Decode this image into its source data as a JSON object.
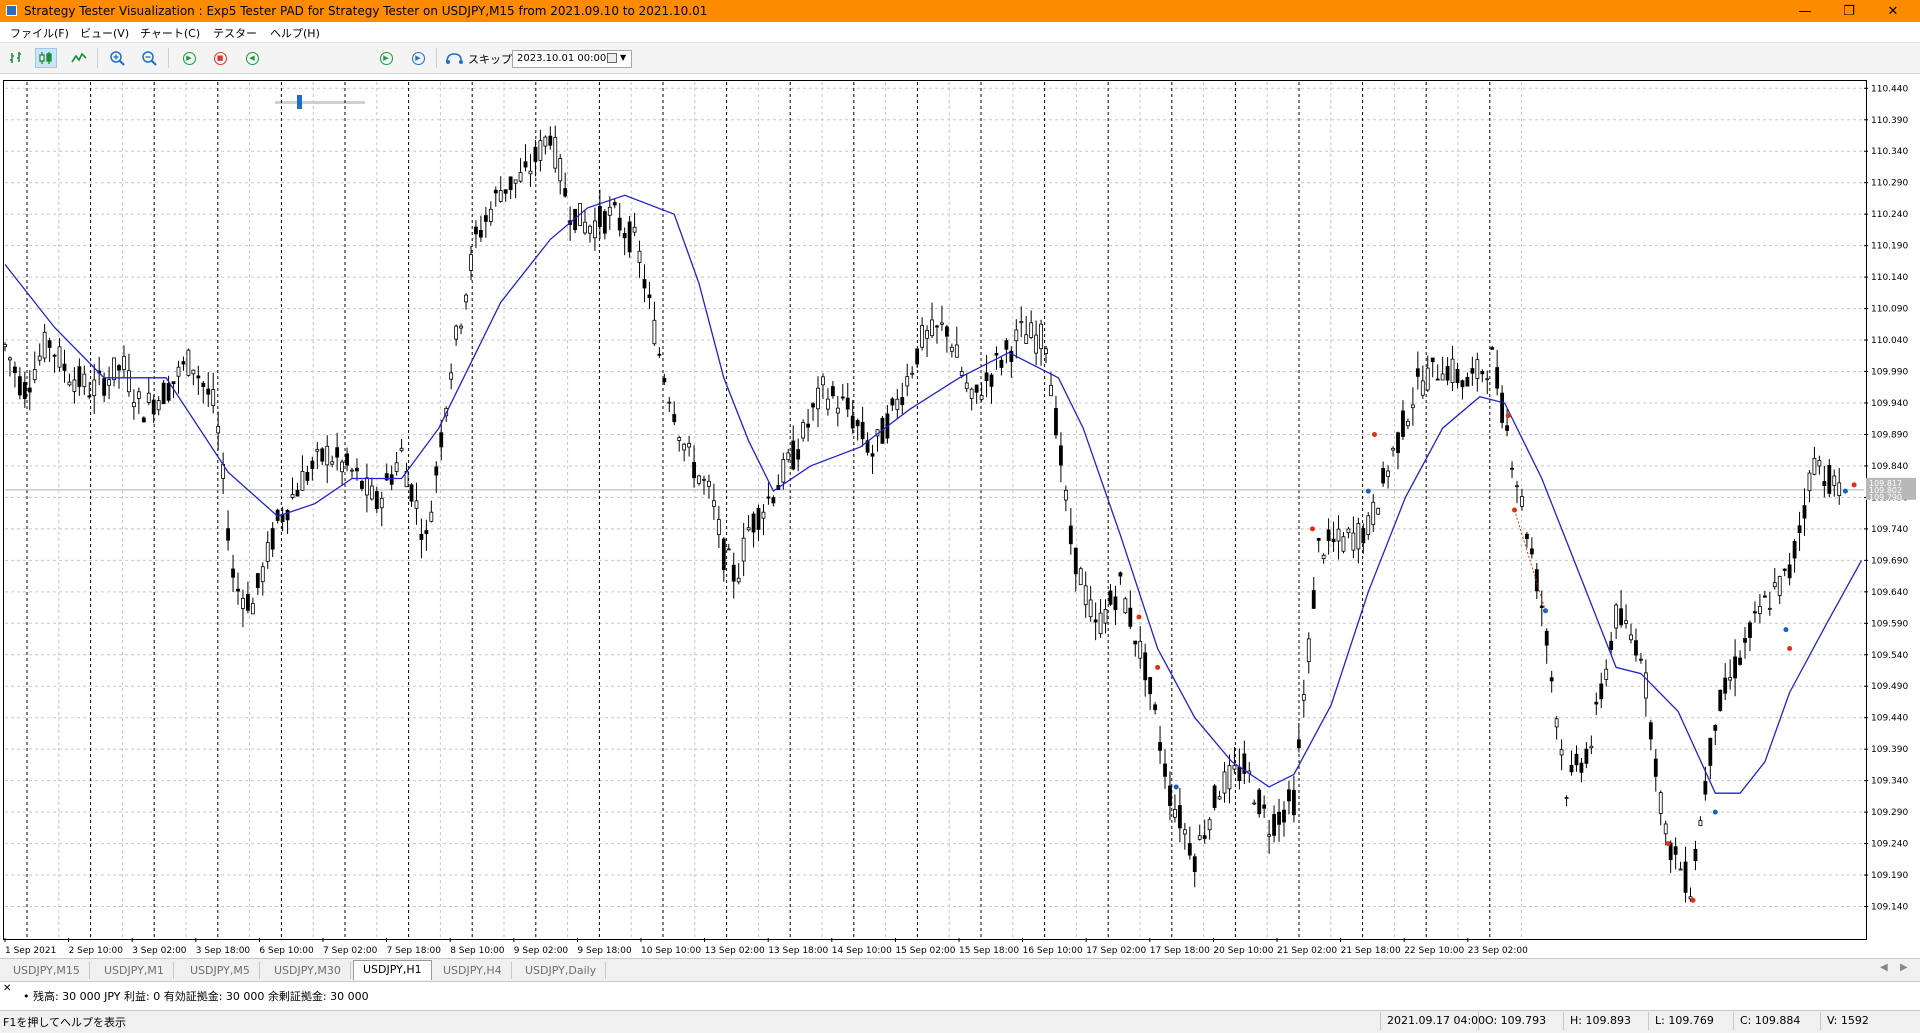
{
  "window": {
    "title": "Strategy Tester Visualization : Exp5 Tester PAD for Strategy Tester on USDJPY,M15 from 2021.09.10 to 2021.10.01",
    "minimize": "—",
    "maximize": "❐",
    "close": "✕"
  },
  "menu": {
    "items": [
      {
        "label": "ファイル(F)"
      },
      {
        "label": "ビュー(V)"
      },
      {
        "label": "チャート(C)"
      },
      {
        "label": "テスター"
      },
      {
        "label": "ヘルプ(H)"
      }
    ]
  },
  "toolbar": {
    "skip_label": "スキップ",
    "date_value": "2023.10.01 00:00",
    "icons": [
      "bar-chart-icon",
      "candlestick-icon",
      "line-chart-icon",
      "zoom-in-icon",
      "zoom-out-icon",
      "play-icon",
      "stop-icon",
      "rewind-icon",
      "speed-slider",
      "fast-forward-icon",
      "skip-end-icon",
      "skip-icon",
      "calendar-icon"
    ],
    "speed_level": 0.25
  },
  "chart_data": {
    "type": "candlestick",
    "symbol": "USDJPY",
    "timeframe": "H1",
    "price_ticks": [
      "110.440",
      "110.390",
      "110.340",
      "110.290",
      "110.240",
      "110.190",
      "110.140",
      "110.090",
      "110.040",
      "109.990",
      "109.940",
      "109.890",
      "109.840",
      "109.790",
      "109.740",
      "109.690",
      "109.640",
      "109.590",
      "109.540",
      "109.490",
      "109.440",
      "109.390",
      "109.340",
      "109.290",
      "109.240",
      "109.190",
      "109.140"
    ],
    "price_min": 109.09,
    "price_max": 110.45,
    "current_price_labels": [
      "109.817",
      "109.802",
      "109.790"
    ],
    "time_labels": [
      "1 Sep 2021",
      "2 Sep 10:00",
      "3 Sep 02:00",
      "3 Sep 18:00",
      "6 Sep 10:00",
      "7 Sep 02:00",
      "7 Sep 18:00",
      "8 Sep 10:00",
      "9 Sep 02:00",
      "9 Sep 18:00",
      "10 Sep 10:00",
      "13 Sep 02:00",
      "13 Sep 18:00",
      "14 Sep 10:00",
      "15 Sep 02:00",
      "15 Sep 18:00",
      "16 Sep 10:00",
      "17 Sep 02:00",
      "17 Sep 18:00",
      "20 Sep 10:00",
      "21 Sep 02:00",
      "21 Sep 18:00",
      "22 Sep 10:00",
      "23 Sep 02:00"
    ],
    "price_path": [
      [
        0,
        110.03
      ],
      [
        15,
        109.96
      ],
      [
        35,
        110.04
      ],
      [
        50,
        109.99
      ],
      [
        70,
        109.96
      ],
      [
        95,
        110.0
      ],
      [
        110,
        109.93
      ],
      [
        130,
        109.96
      ],
      [
        150,
        110.01
      ],
      [
        170,
        109.93
      ],
      [
        185,
        109.65
      ],
      [
        200,
        109.62
      ],
      [
        220,
        109.75
      ],
      [
        240,
        109.82
      ],
      [
        260,
        109.86
      ],
      [
        280,
        109.83
      ],
      [
        300,
        109.78
      ],
      [
        320,
        109.86
      ],
      [
        340,
        109.72
      ],
      [
        360,
        110.0
      ],
      [
        380,
        110.2
      ],
      [
        400,
        110.28
      ],
      [
        420,
        110.3
      ],
      [
        440,
        110.37
      ],
      [
        455,
        110.25
      ],
      [
        470,
        110.22
      ],
      [
        490,
        110.24
      ],
      [
        510,
        110.19
      ],
      [
        530,
        110.0
      ],
      [
        550,
        109.86
      ],
      [
        570,
        109.79
      ],
      [
        580,
        109.7
      ],
      [
        590,
        109.66
      ],
      [
        600,
        109.74
      ],
      [
        620,
        109.8
      ],
      [
        640,
        109.87
      ],
      [
        660,
        109.96
      ],
      [
        680,
        109.93
      ],
      [
        700,
        109.86
      ],
      [
        720,
        109.94
      ],
      [
        740,
        110.04
      ],
      [
        760,
        110.06
      ],
      [
        780,
        109.94
      ],
      [
        800,
        110.0
      ],
      [
        820,
        110.05
      ],
      [
        840,
        110.04
      ],
      [
        860,
        109.72
      ],
      [
        880,
        109.58
      ],
      [
        900,
        109.65
      ],
      [
        920,
        109.52
      ],
      [
        940,
        109.32
      ],
      [
        960,
        109.22
      ],
      [
        980,
        109.33
      ],
      [
        1000,
        109.36
      ],
      [
        1020,
        109.27
      ],
      [
        1040,
        109.31
      ],
      [
        1060,
        109.71
      ],
      [
        1080,
        109.72
      ],
      [
        1100,
        109.74
      ],
      [
        1120,
        109.86
      ],
      [
        1140,
        109.97
      ],
      [
        1160,
        110.0
      ],
      [
        1180,
        109.97
      ],
      [
        1200,
        110.01
      ],
      [
        1220,
        109.82
      ],
      [
        1240,
        109.62
      ],
      [
        1260,
        109.33
      ],
      [
        1280,
        109.4
      ],
      [
        1300,
        109.6
      ],
      [
        1320,
        109.55
      ],
      [
        1340,
        109.25
      ],
      [
        1360,
        109.17
      ],
      [
        1380,
        109.44
      ],
      [
        1400,
        109.54
      ],
      [
        1420,
        109.62
      ],
      [
        1440,
        109.67
      ],
      [
        1460,
        109.85
      ],
      [
        1480,
        109.8
      ]
    ],
    "ma_path": [
      [
        0,
        110.16
      ],
      [
        40,
        110.06
      ],
      [
        80,
        109.98
      ],
      [
        130,
        109.98
      ],
      [
        180,
        109.83
      ],
      [
        220,
        109.76
      ],
      [
        250,
        109.78
      ],
      [
        280,
        109.82
      ],
      [
        320,
        109.82
      ],
      [
        350,
        109.9
      ],
      [
        400,
        110.1
      ],
      [
        440,
        110.2
      ],
      [
        470,
        110.25
      ],
      [
        500,
        110.27
      ],
      [
        540,
        110.24
      ],
      [
        560,
        110.13
      ],
      [
        580,
        109.98
      ],
      [
        600,
        109.88
      ],
      [
        620,
        109.8
      ],
      [
        650,
        109.84
      ],
      [
        690,
        109.87
      ],
      [
        730,
        109.93
      ],
      [
        770,
        109.98
      ],
      [
        810,
        110.02
      ],
      [
        850,
        109.98
      ],
      [
        870,
        109.9
      ],
      [
        900,
        109.73
      ],
      [
        930,
        109.55
      ],
      [
        960,
        109.44
      ],
      [
        990,
        109.37
      ],
      [
        1020,
        109.33
      ],
      [
        1040,
        109.35
      ],
      [
        1070,
        109.46
      ],
      [
        1100,
        109.64
      ],
      [
        1130,
        109.79
      ],
      [
        1160,
        109.9
      ],
      [
        1190,
        109.95
      ],
      [
        1210,
        109.94
      ],
      [
        1240,
        109.82
      ],
      [
        1270,
        109.67
      ],
      [
        1300,
        109.52
      ],
      [
        1320,
        109.51
      ],
      [
        1350,
        109.45
      ],
      [
        1380,
        109.32
      ],
      [
        1400,
        109.32
      ],
      [
        1420,
        109.37
      ],
      [
        1440,
        109.48
      ],
      [
        1470,
        109.59
      ],
      [
        1498,
        109.69
      ]
    ],
    "grid": true
  },
  "tabs": [
    {
      "label": "USDJPY,M15",
      "active": false
    },
    {
      "label": "USDJPY,M1",
      "active": false
    },
    {
      "label": "USDJPY,M5",
      "active": false
    },
    {
      "label": "USDJPY,M30",
      "active": false
    },
    {
      "label": "USDJPY,H1",
      "active": true
    },
    {
      "label": "USDJPY,H4",
      "active": false
    },
    {
      "label": "USDJPY,Daily",
      "active": false
    }
  ],
  "journal": {
    "text": "• 残高: 30 000 JPY  利益: 0  有効証拠金: 30 000  余剰証拠金: 30 000"
  },
  "status": {
    "help": "F1を押してヘルプを表示",
    "time": "2021.09.17 04:00",
    "open": "O: 109.793",
    "high": "H: 109.893",
    "low": "L: 109.769",
    "close": "C: 109.884",
    "volume": "V: 1592"
  },
  "colors": {
    "title_bar": "#ff8c00",
    "ma_line": "#2222cc",
    "sell_marker": "#e03010",
    "buy_marker": "#1a60c8"
  }
}
